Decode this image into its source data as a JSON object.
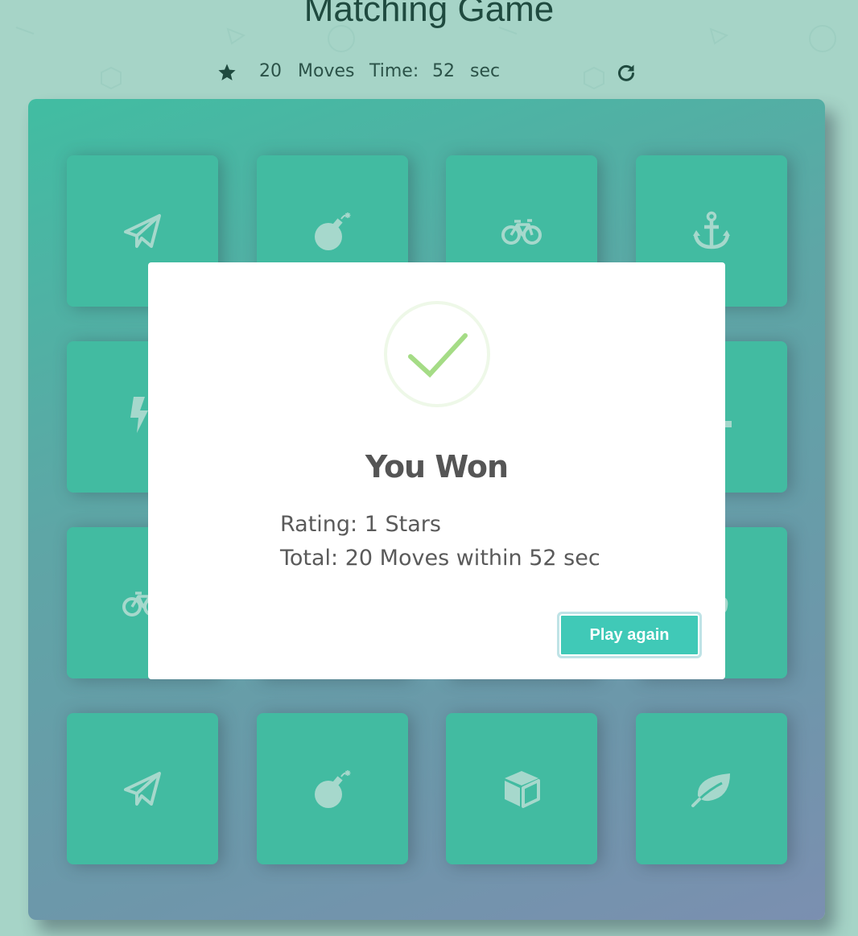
{
  "title": "Matching Game",
  "score_panel": {
    "star_icon": "star-icon",
    "moves_count": "20",
    "moves_label": "Moves",
    "time_label": "Time:",
    "time_value": "52",
    "time_unit": "sec",
    "restart_icon": "redo-icon"
  },
  "deck": {
    "cards": [
      {
        "icon": "paper-plane-icon"
      },
      {
        "icon": "bomb-icon"
      },
      {
        "icon": "bicycle-icon"
      },
      {
        "icon": "anchor-icon"
      },
      {
        "icon": "bolt-icon"
      },
      {
        "icon": "hidden"
      },
      {
        "icon": "hidden"
      },
      {
        "icon": "anchor-icon"
      },
      {
        "icon": "bicycle-icon"
      },
      {
        "icon": "hidden"
      },
      {
        "icon": "hidden"
      },
      {
        "icon": "leaf-icon"
      },
      {
        "icon": "paper-plane-icon"
      },
      {
        "icon": "bomb-icon"
      },
      {
        "icon": "cube-icon"
      },
      {
        "icon": "leaf-icon"
      }
    ]
  },
  "modal": {
    "check_icon": "check-icon",
    "title": "You Won",
    "rating": "Rating: 1 Stars",
    "total": "Total: 20 Moves within 52 sec",
    "play_again_label": "Play again"
  },
  "colors": {
    "background": "#a6d4c7",
    "card": "#42bba1",
    "card_icon": "#a6d8cc",
    "button": "#40c9b7",
    "check": "#a5dc86"
  }
}
